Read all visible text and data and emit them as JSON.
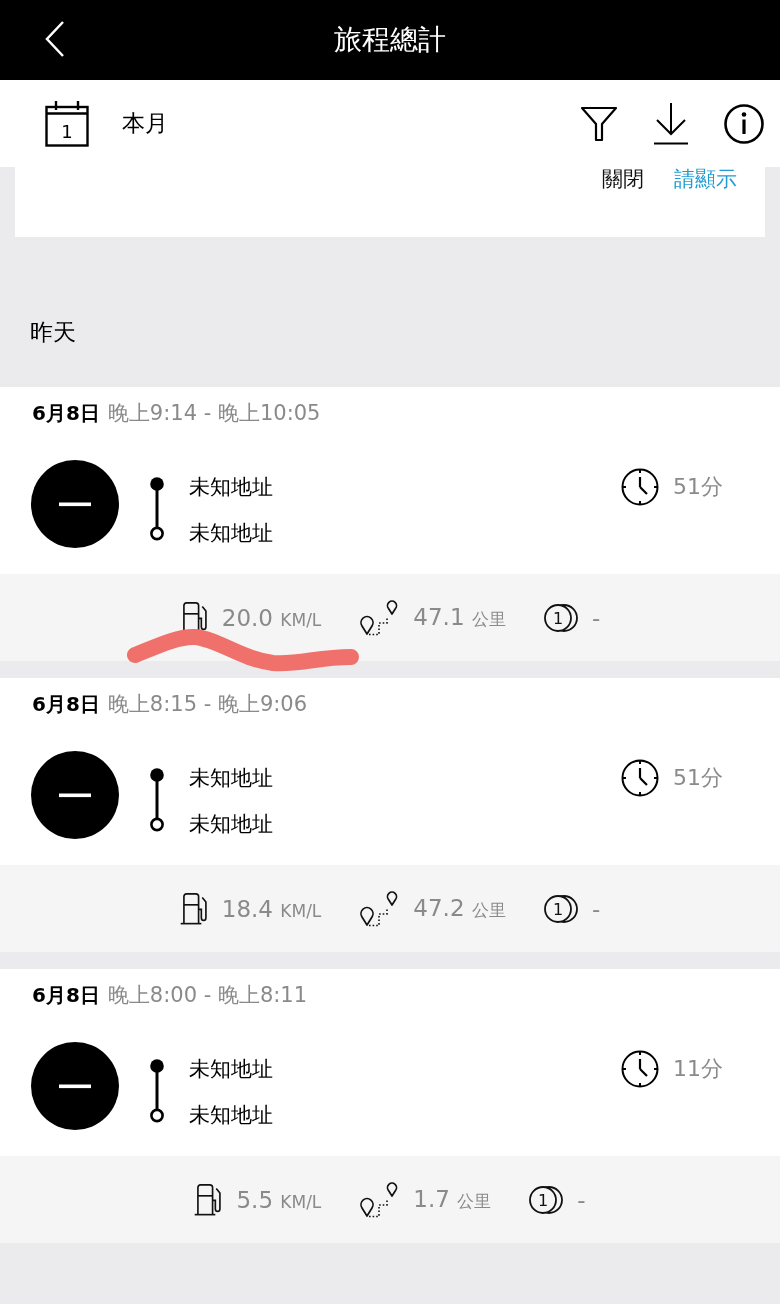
{
  "header": {
    "title": "旅程總計"
  },
  "toolbar": {
    "calendar_day": "1",
    "period": "本月"
  },
  "notice": {
    "close": "關閉",
    "show": "請顯示"
  },
  "section": {
    "label": "昨天"
  },
  "trips": [
    {
      "date": "6月8日",
      "time_range": "晚上9:14 - 晚上10:05",
      "start": "未知地址",
      "end": "未知地址",
      "duration": "51分",
      "economy": {
        "value": "20.0",
        "unit": "KM/L"
      },
      "distance": {
        "value": "47.1",
        "unit": "公里"
      },
      "cost_icon_label": "1",
      "cost": "-",
      "scribbled": true
    },
    {
      "date": "6月8日",
      "time_range": "晚上8:15 - 晚上9:06",
      "start": "未知地址",
      "end": "未知地址",
      "duration": "51分",
      "economy": {
        "value": "18.4",
        "unit": "KM/L"
      },
      "distance": {
        "value": "47.2",
        "unit": "公里"
      },
      "cost_icon_label": "1",
      "cost": "-",
      "scribbled": false
    },
    {
      "date": "6月8日",
      "time_range": "晚上8:00 - 晚上8:11",
      "start": "未知地址",
      "end": "未知地址",
      "duration": "11分",
      "economy": {
        "value": "5.5",
        "unit": "KM/L"
      },
      "distance": {
        "value": "1.7",
        "unit": "公里"
      },
      "cost_icon_label": "1",
      "cost": "-",
      "scribbled": false
    }
  ]
}
